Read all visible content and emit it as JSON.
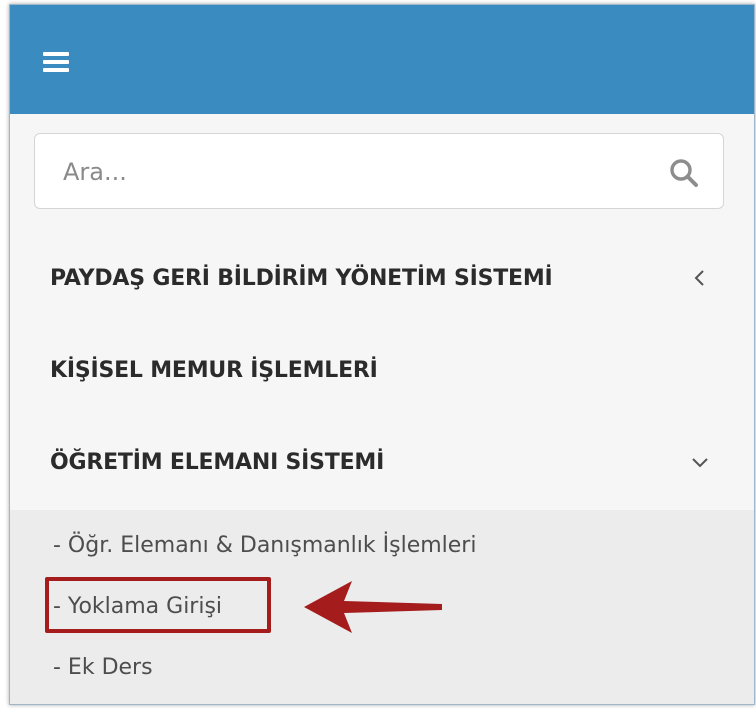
{
  "search": {
    "placeholder": "Ara..."
  },
  "menu": {
    "items": [
      {
        "label": "PAYDAŞ GERİ BİLDİRİM YÖNETİM SİSTEMİ",
        "chevron": "chevron-left-icon"
      },
      {
        "label": "KİŞİSEL MEMUR İŞLEMLERİ"
      },
      {
        "label": "ÖĞRETİM ELEMANI SİSTEMİ",
        "chevron": "chevron-down-icon"
      }
    ],
    "submenu": [
      {
        "label": "- Öğr. Elemanı & Danışmanlık İşlemleri"
      },
      {
        "label": "- Yoklama Girişi",
        "highlighted": true
      },
      {
        "label": "- Ek Ders"
      }
    ]
  },
  "colors": {
    "topbar": "#3a8bbf",
    "annotation": "#a51c1c"
  }
}
